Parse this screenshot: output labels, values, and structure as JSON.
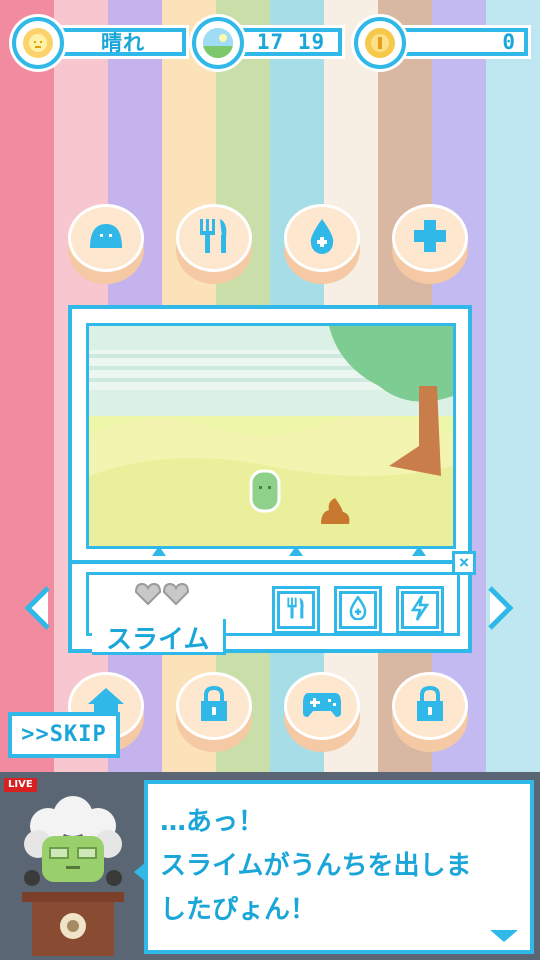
{
  "colors": {
    "accent": "#2fb8e8",
    "stripes": [
      "#f28aa0",
      "#f7c6cf",
      "#c4b3ec",
      "#fbe2b8",
      "#c9dea8",
      "#a7dde6",
      "#f7efe4",
      "#d8b7a3",
      "#c3baf2",
      "#bfe7f2"
    ]
  },
  "status": {
    "weather": {
      "icon": "sun-face-icon",
      "value": "晴れ"
    },
    "time": {
      "icon": "landscape-icon",
      "value": "17 19"
    },
    "coins": {
      "icon": "coin-icon",
      "value": "0"
    }
  },
  "top_actions": [
    {
      "name": "slime",
      "icon": "slime-icon"
    },
    {
      "name": "feed",
      "icon": "fork-knife-icon"
    },
    {
      "name": "water",
      "icon": "water-drop-icon"
    },
    {
      "name": "heal",
      "icon": "plus-icon"
    }
  ],
  "bottom_actions": [
    {
      "name": "home",
      "icon": "home-icon"
    },
    {
      "name": "locked-1",
      "icon": "lock-icon"
    },
    {
      "name": "game",
      "icon": "gamepad-icon"
    },
    {
      "name": "locked-2",
      "icon": "lock-icon"
    }
  ],
  "creature": {
    "name": "スライム",
    "hearts": 2,
    "stats": [
      {
        "name": "food",
        "icon": "fork-knife-icon"
      },
      {
        "name": "water",
        "icon": "water-drop-icon"
      },
      {
        "name": "energy",
        "icon": "lightning-icon"
      }
    ]
  },
  "skip_label": ">>SKIP",
  "live_label": "LIVE",
  "dialog": {
    "text": "…あっ！\nスライムがうんちを出しま\nしたぴょん！"
  }
}
